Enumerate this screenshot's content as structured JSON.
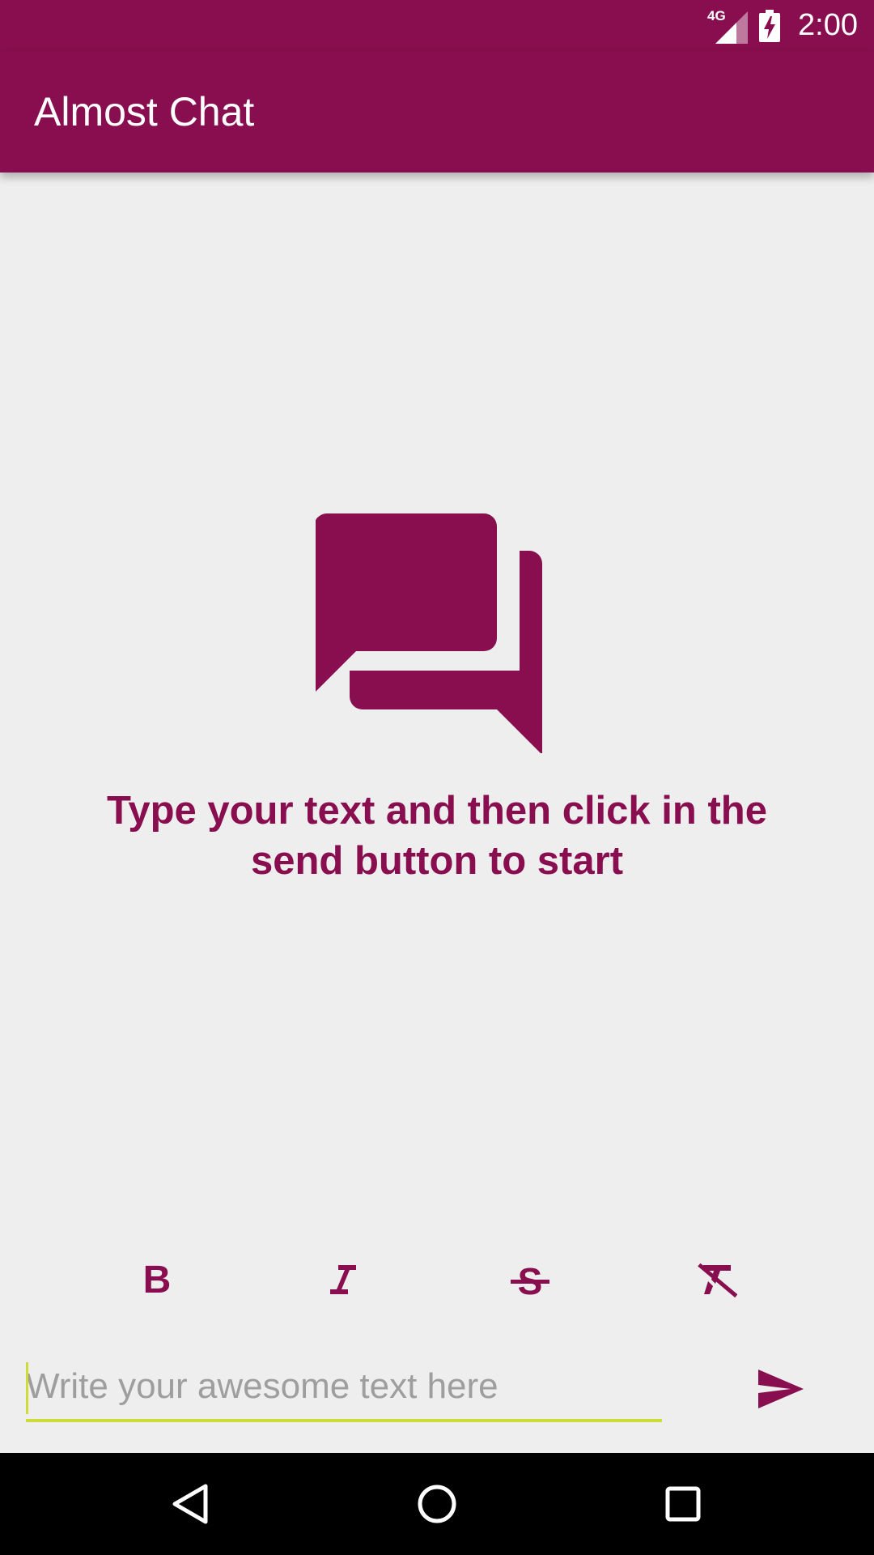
{
  "status_bar": {
    "network": "4G",
    "time": "2:00",
    "icons": [
      "network-4g-icon",
      "signal-icon",
      "battery-charging-icon"
    ]
  },
  "app_bar": {
    "title": "Almost Chat"
  },
  "empty_state": {
    "icon": "forum-chat-icon",
    "message": "Type your text and then click in the send button to start"
  },
  "format_toolbar": {
    "items": [
      {
        "name": "bold",
        "icon": "format-bold-icon"
      },
      {
        "name": "italic",
        "icon": "format-italic-icon"
      },
      {
        "name": "strikethrough",
        "icon": "format-strikethrough-icon"
      },
      {
        "name": "clear",
        "icon": "format-clear-icon"
      }
    ]
  },
  "message_input": {
    "placeholder": "Write your awesome text here",
    "value": ""
  },
  "send": {
    "icon": "send-icon"
  },
  "nav_bar": {
    "items": [
      "back-icon",
      "home-icon",
      "recents-icon"
    ]
  },
  "colors": {
    "primary": "#880e4f",
    "accent": "#cddc39",
    "background": "#eeeeee"
  }
}
